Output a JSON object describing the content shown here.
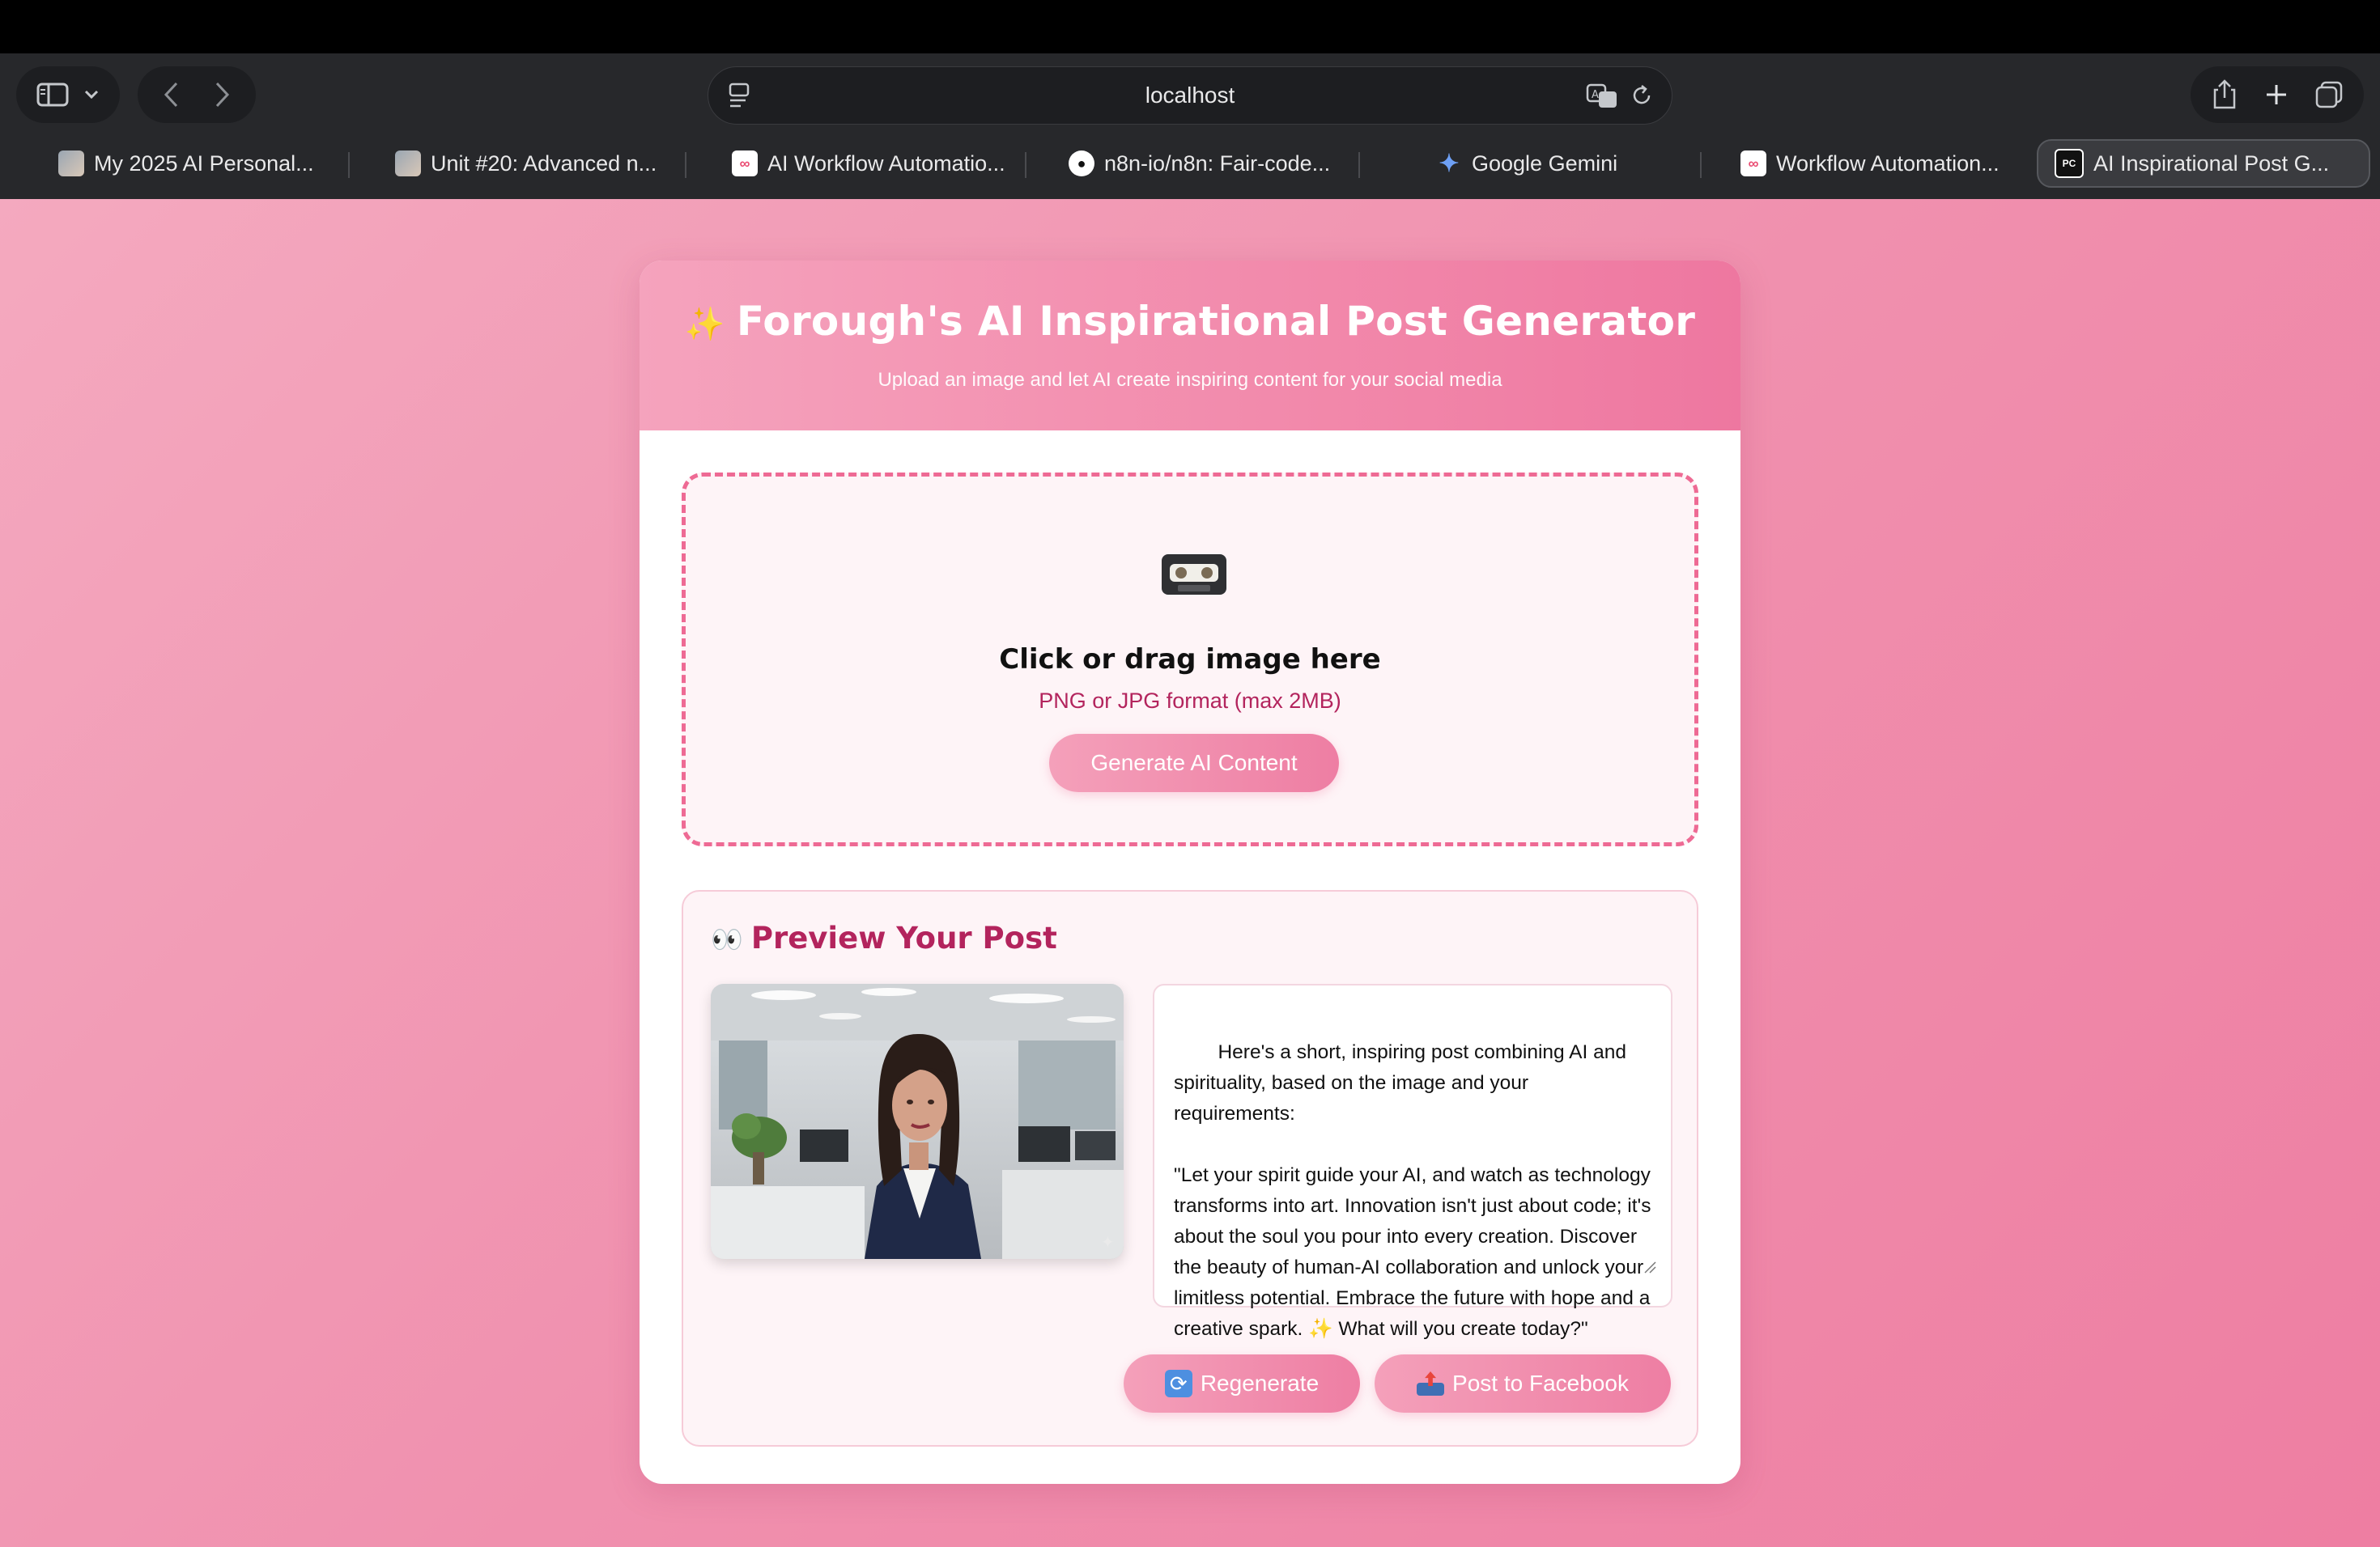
{
  "browser": {
    "address": "localhost",
    "tabs": [
      {
        "label": "My 2025 AI Personal...",
        "icon": "image-thumb-icon"
      },
      {
        "label": "Unit #20: Advanced n...",
        "icon": "image-thumb-icon"
      },
      {
        "label": "AI Workflow Automatio...",
        "icon": "n8n-icon"
      },
      {
        "label": "n8n-io/n8n: Fair-code...",
        "icon": "github-icon"
      },
      {
        "label": "Google Gemini",
        "icon": "gemini-icon"
      },
      {
        "label": "Workflow Automation...",
        "icon": "n8n-icon"
      },
      {
        "label": "AI Inspirational Post G...",
        "icon": "pycharm-icon",
        "active": true
      }
    ]
  },
  "app": {
    "title": "Forough's AI Inspirational Post Generator",
    "subtitle": "Upload an image and let AI create inspiring content for your social media",
    "upload": {
      "heading": "Click or drag image here",
      "hint": "PNG or JPG format (max 2MB)",
      "generate_label": "Generate AI Content"
    },
    "preview": {
      "title": "Preview Your Post",
      "post_text": "Here's a short, inspiring post combining AI and spirituality, based on the image and your requirements:\n\n\"Let your spirit guide your AI, and watch as technology transforms into art. Innovation isn't just about code; it's about the soul you pour into every creation. Discover the beauty of human-AI collaboration and unlock your limitless potential. Embrace the future with hope and a creative spark. ✨ What will you create today?\"",
      "regenerate_label": "Regenerate",
      "post_label": "Post to Facebook"
    }
  },
  "colors": {
    "accent": "#ee6a94",
    "title_pink": "#b3245d",
    "background_start": "#f4a9bf",
    "background_end": "#ee7ea2"
  }
}
